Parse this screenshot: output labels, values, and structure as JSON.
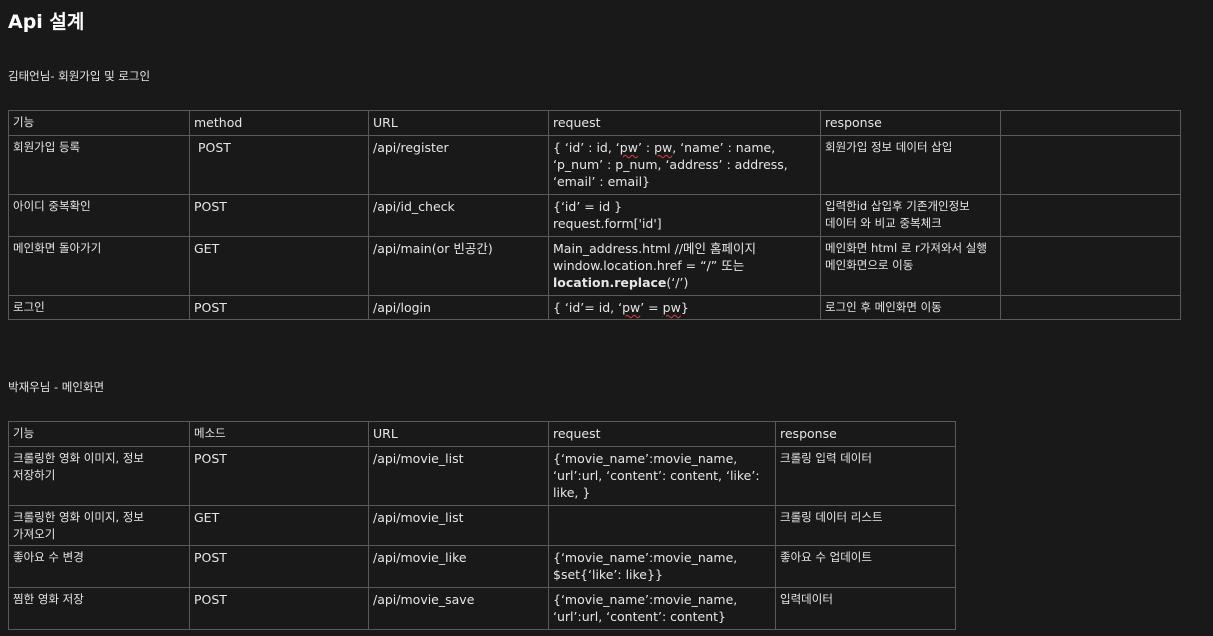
{
  "page": {
    "title": "Api 설계"
  },
  "section1": {
    "heading": "김태언님-  회원가입 및 로그인",
    "headers": [
      "기능",
      "method",
      "URL",
      "request",
      "response",
      ""
    ],
    "rows": [
      {
        "feature": "회원가입 등록",
        "method": " POST",
        "url": "/api/register",
        "request": {
          "p1": "{ ‘id’ : id, ‘",
          "u1": "pw",
          "p2": "’ : ",
          "u2": "pw",
          "p3": ", ‘name’ : name, ‘p_num’ : p_num, ‘address’ : address, ‘email’ : email}"
        },
        "response": "회원가입 정보 데이터 삽입",
        "extra": ""
      },
      {
        "feature": "아이디 중복확인",
        "method": "POST",
        "url": "/api/id_check",
        "request": {
          "line1": "{‘id’ = id }",
          "line2": "request.form['id']"
        },
        "response": "입력한id 삽입후 기존개인정보 데이터 와 비교 중복체크",
        "extra": ""
      },
      {
        "feature": "메인화면 돌아가기",
        "method": "GET",
        "url": "/api/main(or 빈공간)",
        "request": {
          "line1": "Main_address.html  //메인 홈페이지",
          "line2": "window.location.href = “/” 또는",
          "line3_bold": "location.replace",
          "line3_rest": "(‘/’)"
        },
        "response": "메인화면 html 로 r가져와서 실행 메인화면으로  이동",
        "extra": ""
      },
      {
        "feature": "로그인",
        "method": "POST",
        "url": "/api/login",
        "request": {
          "p1": "{ ‘id’= id, ‘",
          "u1": "pw",
          "p2": "’ = ",
          "u2": "pw",
          "p3": "}"
        },
        "response": "로그인 후 메인화면 이동",
        "extra": ""
      }
    ]
  },
  "section2": {
    "heading": "박재우님 - 메인화면",
    "headers": [
      "기능",
      "메소드",
      "URL",
      "request",
      "response"
    ],
    "rows": [
      {
        "feature": "크롤링한 영화 이미지, 정보 저장하기",
        "method": "POST",
        "url": "/api/movie_list",
        "request": "{‘movie_name’:movie_name, ‘url’:url, ‘content’: content, ‘like’: like, }",
        "response": "크롤링 입력 데이터"
      },
      {
        "feature": "크롤링한 영화 이미지, 정보 가져오기",
        "method": "GET",
        "url": "/api/movie_list",
        "request": "",
        "response": "크롤링 데이터 리스트"
      },
      {
        "feature": "좋아요 수 변경",
        "method": "POST",
        "url": "/api/movie_like",
        "request": "{‘movie_name’:movie_name, $set{‘like’: like}}",
        "response": "좋아요 수 업데이트"
      },
      {
        "feature": "찜한 영화 저장",
        "method": "POST",
        "url": "/api/movie_save",
        "request": "{‘movie_name’:movie_name, ‘url’:url, ‘content’: content}",
        "response": "입력데이터"
      }
    ]
  }
}
